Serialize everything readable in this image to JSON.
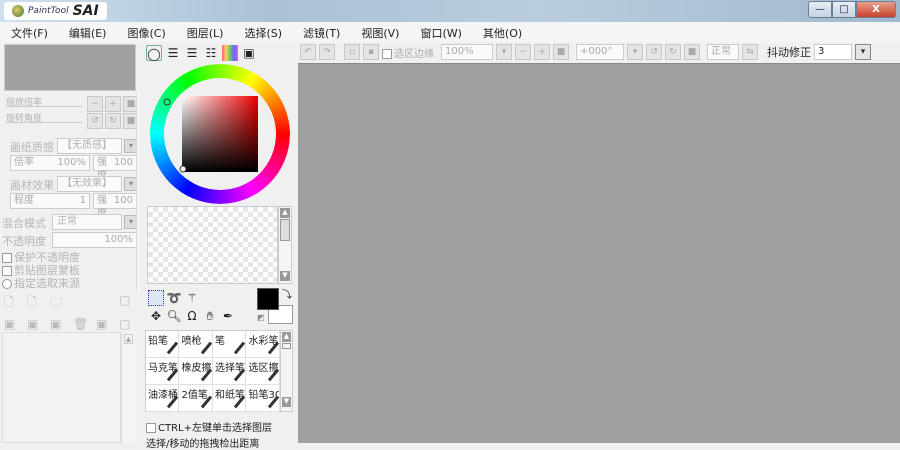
{
  "app": {
    "logo_small": "PaintTool",
    "logo_big": "SAI",
    "minimize": "—",
    "maximize": "□",
    "close": "X"
  },
  "menu": [
    "文件(F)",
    "编辑(E)",
    "图像(C)",
    "图层(L)",
    "选择(S)",
    "滤镜(T)",
    "视图(V)",
    "窗口(W)",
    "其他(O)"
  ],
  "toolbar": {
    "selection_edge": "选区边缘",
    "zoom": "100%",
    "rotation": "+000°",
    "blend": "正常",
    "stabilizer_label": "抖动修正",
    "stabilizer_value": "3"
  },
  "navigator": {
    "zoom_label": "缩放倍率",
    "rotate_label": "旋转角度"
  },
  "layer_panel": {
    "paper_texture_label": "画纸质感",
    "paper_texture_value": "【无质感】",
    "scale_label": "倍率",
    "scale_value": "100%",
    "strength_label": "强度",
    "strength_value": "100",
    "material_label": "画材效果",
    "material_value": "【无效果】",
    "degree_label": "程度",
    "degree_value": "1",
    "strength2_label": "强度",
    "strength2_value": "100",
    "blend_label": "混合模式",
    "blend_value": "正常",
    "opacity_label": "不透明度",
    "opacity_value": "100%",
    "protect_opacity": "保护不透明度",
    "clip_mask": "剪贴图层蒙板",
    "selection_source": "指定选取来源"
  },
  "brushes": [
    {
      "name": "铅笔"
    },
    {
      "name": "喷枪"
    },
    {
      "name": "笔"
    },
    {
      "name": "水彩笔"
    },
    {
      "name": "马克笔"
    },
    {
      "name": "橡皮擦"
    },
    {
      "name": "选择笔"
    },
    {
      "name": "选区擦"
    },
    {
      "name": "油漆桶"
    },
    {
      "name": "2值笔"
    },
    {
      "name": "和纸笔"
    },
    {
      "name": "铅笔30"
    }
  ],
  "options": {
    "ctrl_select": "CTRL+左键单击选择图层",
    "drag_distance": "选择/移动的拖拽检出距离"
  },
  "colors": {
    "primary": "#000000",
    "secondary": "#ffffff",
    "canvas": "#a0a0a0"
  }
}
